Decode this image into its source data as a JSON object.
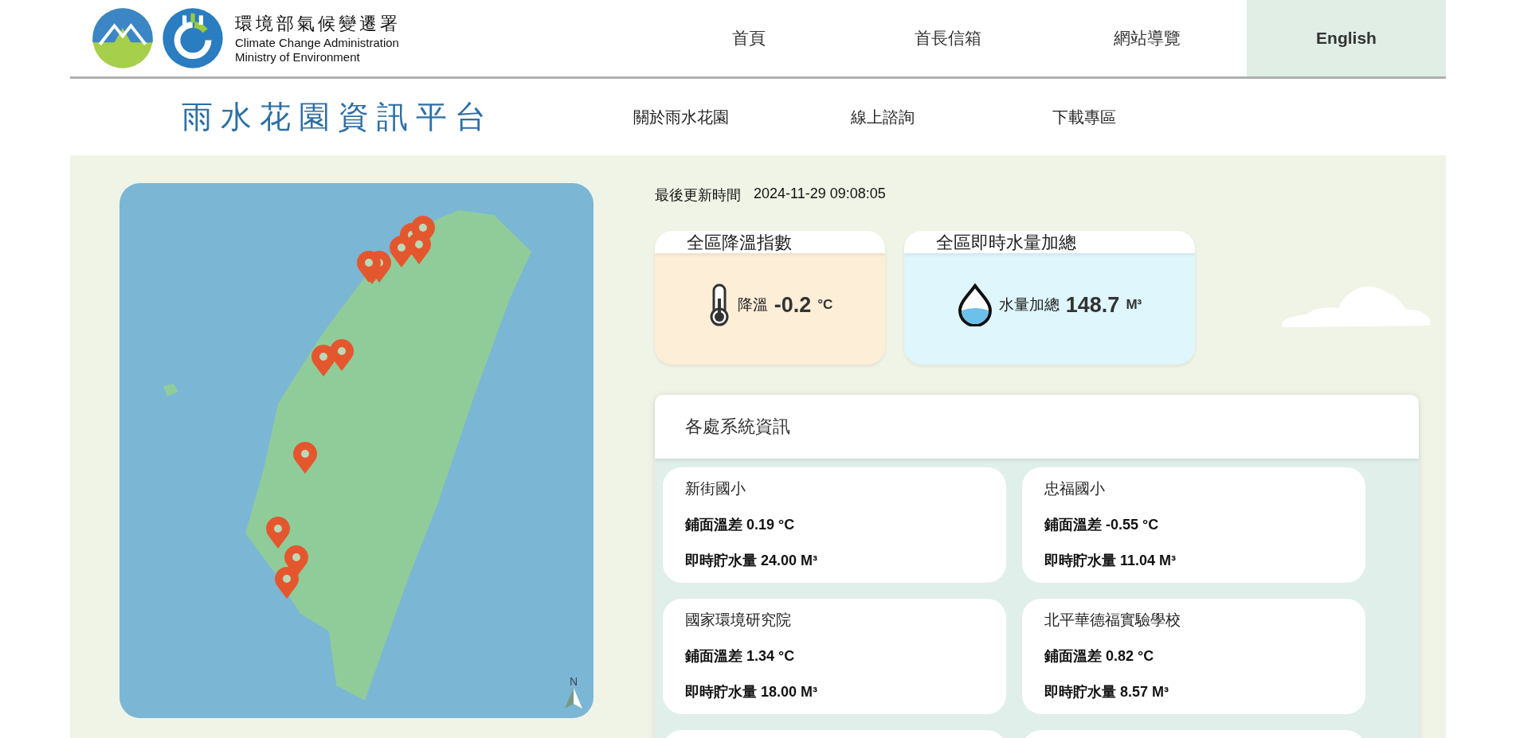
{
  "header": {
    "agency_name": "環境部氣候變遷署",
    "agency_name_en": [
      "Climate Change Administration",
      "Ministry of Environment"
    ],
    "nav": [
      {
        "label": "首頁",
        "selected": false
      },
      {
        "label": "首長信箱",
        "selected": false
      },
      {
        "label": "網站導覽",
        "selected": false
      },
      {
        "label": "English",
        "selected": true
      }
    ]
  },
  "subheader": {
    "title": "雨水花園資訊平台",
    "nav": [
      "關於雨水花園",
      "線上諮詢",
      "下載專區"
    ]
  },
  "map": {
    "north_label": "N"
  },
  "update": {
    "label": "最後更新時間",
    "value": "2024-11-29 09:08:05"
  },
  "summary_cards": [
    {
      "kind": "temperature",
      "title": "全區降溫指數",
      "label": "降溫",
      "value": "-0.2",
      "unit": "°C"
    },
    {
      "kind": "water",
      "title": "全區即時水量加總",
      "label": "水量加總",
      "value": "148.7",
      "unit": "M³"
    }
  ],
  "stations_panel": {
    "title": "各處系統資訊",
    "stations": [
      {
        "name": "新街國小",
        "temperature": "鋪面溫差 0.19 °C",
        "water": "即時貯水量 24.00 M³"
      },
      {
        "name": "忠福國小",
        "temperature": "鋪面溫差 -0.55 °C",
        "water": "即時貯水量 11.04 M³"
      },
      {
        "name": "國家環境研究院",
        "temperature": "鋪面溫差 1.34 °C",
        "water": "即時貯水量 18.00 M³"
      },
      {
        "name": "北平華德福實驗學校",
        "temperature": "鋪面溫差 0.82 °C",
        "water": "即時貯水量 8.57 M³"
      }
    ]
  }
}
